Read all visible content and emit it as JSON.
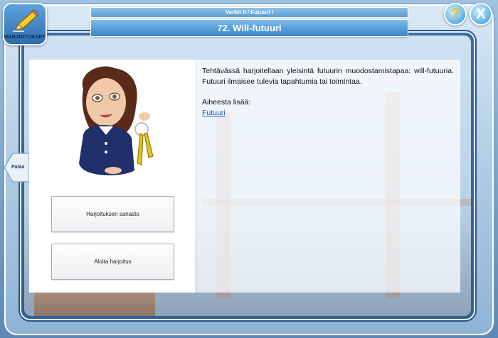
{
  "header": {
    "breadcrumb": "Verbit II / Futuuri /",
    "title": "72. Will-futuuri"
  },
  "toolbar": {
    "exercises_label": "HARJOITUKSET",
    "help_symbol": "?",
    "close_symbol": "X",
    "back_label": "Palaa"
  },
  "left_panel": {
    "vocab_button": "Harjoituksen sanasto",
    "start_button": "Aloita harjoitus"
  },
  "right_panel": {
    "description": "Tehtävässä harjoitellaan yleisintä futuurin muodostamistapaa: will-futuuria. Futuuri ilmaisee tulevia tapahtumia tai toimintaa.",
    "more_heading": "Aiheesta lisää:",
    "link_label": "Futuuri"
  },
  "icons": {
    "exercises": "pencil-icon",
    "help": "question-icon",
    "close": "close-icon",
    "back": "arrow-left-icon"
  },
  "colors": {
    "accent": "#3a86c8",
    "link": "#1f55c6",
    "help_symbol": "#f2d22a"
  }
}
